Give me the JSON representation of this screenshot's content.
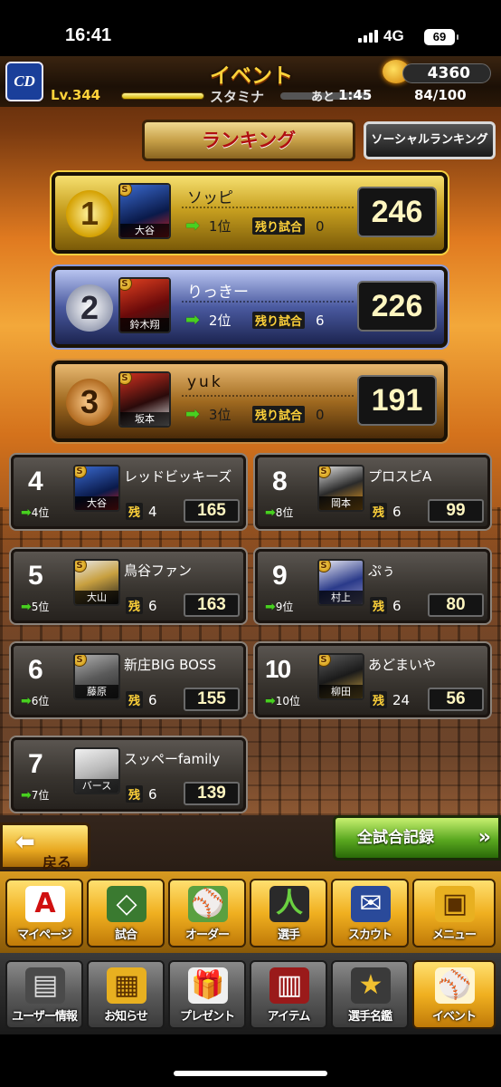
{
  "status": {
    "time": "16:41",
    "network": "4G",
    "battery": "69"
  },
  "header": {
    "title": "イベント",
    "coins": "4360",
    "level_label": "Lv.",
    "level": "344",
    "stamina_label": "スタミナ",
    "ato": "あと",
    "countdown": "1:45",
    "stamina": "84/100"
  },
  "tabs": {
    "ranking": "ランキング",
    "social": "ソーシャルランキング"
  },
  "top3": [
    {
      "rank": "1",
      "name": "ソッピ",
      "player": "大谷",
      "prev": "1位",
      "zan_label": "残り試合",
      "remaining": "0",
      "score": "246"
    },
    {
      "rank": "2",
      "name": "りっきー",
      "player": "鈴木翔",
      "prev": "2位",
      "zan_label": "残り試合",
      "remaining": "6",
      "score": "226"
    },
    {
      "rank": "3",
      "name": "yuk",
      "player": "坂本",
      "prev": "3位",
      "zan_label": "残り試合",
      "remaining": "0",
      "score": "191"
    }
  ],
  "ranks": [
    {
      "rank": "4",
      "name": "レッドビッキーズ",
      "player": "大谷",
      "prev": "4位",
      "zan": "残",
      "remaining": "4",
      "score": "165"
    },
    {
      "rank": "5",
      "name": "鳥谷ファン",
      "player": "大山",
      "prev": "5位",
      "zan": "残",
      "remaining": "6",
      "score": "163"
    },
    {
      "rank": "6",
      "name": "新庄BIG BOSS",
      "player": "藤原",
      "prev": "6位",
      "zan": "残",
      "remaining": "6",
      "score": "155"
    },
    {
      "rank": "7",
      "name": "スッペーfamily",
      "player": "バース",
      "prev": "7位",
      "zan": "残",
      "remaining": "6",
      "score": "139"
    },
    {
      "rank": "8",
      "name": "プロスピA",
      "player": "岡本",
      "prev": "8位",
      "zan": "残",
      "remaining": "6",
      "score": "99"
    },
    {
      "rank": "9",
      "name": "ぷぅ",
      "player": "村上",
      "prev": "9位",
      "zan": "残",
      "remaining": "6",
      "score": "80"
    },
    {
      "rank": "10",
      "name": "あどまいや",
      "player": "柳田",
      "prev": "10位",
      "zan": "残",
      "remaining": "24",
      "score": "56"
    }
  ],
  "badge": "S",
  "team_logo": "CD",
  "buttons": {
    "back": "戻る",
    "all_records": "全試合記録"
  },
  "nav1": [
    {
      "label": "マイページ",
      "icon": "A"
    },
    {
      "label": "試合",
      "icon": "◇"
    },
    {
      "label": "オーダー",
      "icon": "⚾"
    },
    {
      "label": "選手",
      "icon": "人"
    },
    {
      "label": "スカウト",
      "icon": "✉"
    },
    {
      "label": "メニュー",
      "icon": "▣"
    }
  ],
  "nav2": [
    {
      "label": "ユーザー情報",
      "icon": "▤"
    },
    {
      "label": "お知らせ",
      "icon": "▦"
    },
    {
      "label": "プレゼント",
      "icon": "🎁"
    },
    {
      "label": "アイテム",
      "icon": "▥"
    },
    {
      "label": "選手名鑑",
      "icon": "★"
    },
    {
      "label": "イベント",
      "icon": "⚾"
    }
  ]
}
